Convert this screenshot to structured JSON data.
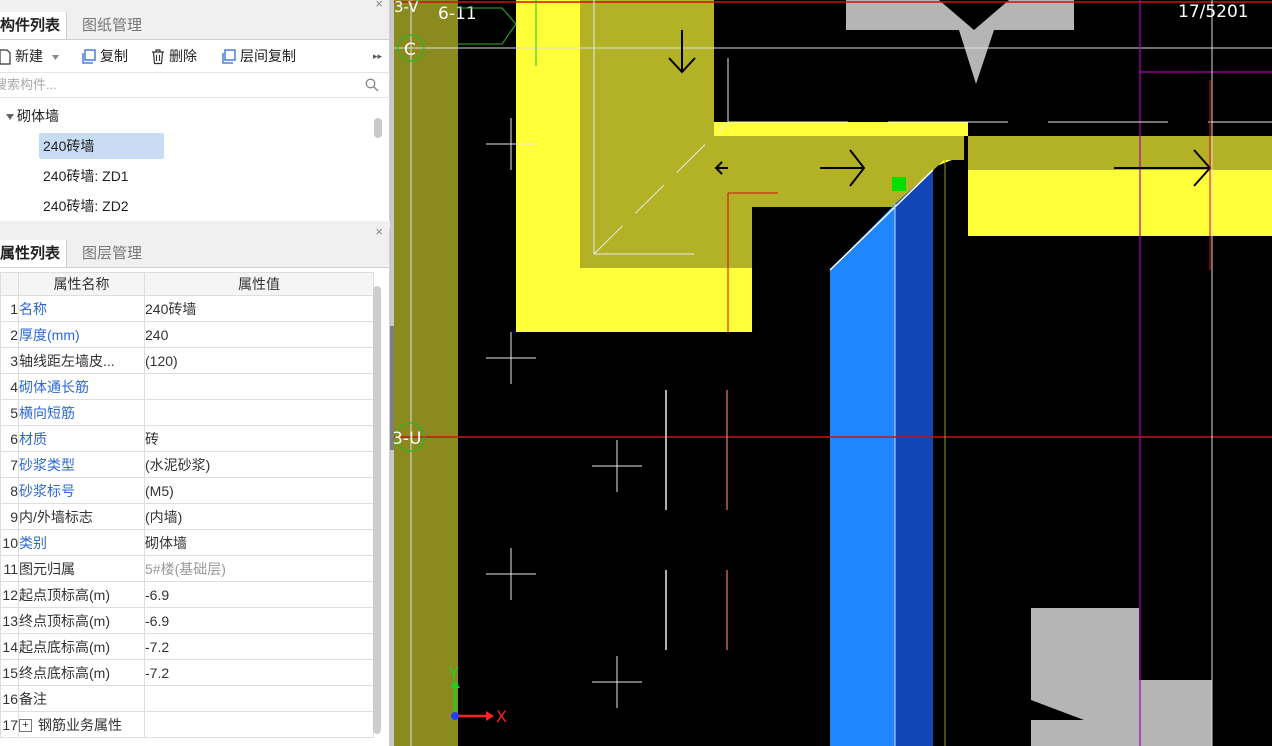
{
  "component_panel": {
    "tabs": [
      {
        "label": "构件列表",
        "active": true
      },
      {
        "label": "图纸管理",
        "active": false
      }
    ],
    "close": "×",
    "toolbar": {
      "new": "新建",
      "copy": "复制",
      "delete": "删除",
      "floor_copy": "层间复制",
      "more": "▸▸"
    },
    "search_placeholder": "搜索构件...",
    "tree": {
      "group": "砌体墙",
      "items": [
        {
          "label": "240砖墙",
          "selected": true
        },
        {
          "label": "240砖墙: ZD1",
          "selected": false
        },
        {
          "label": "240砖墙: ZD2",
          "selected": false
        }
      ]
    }
  },
  "property_panel": {
    "tabs": [
      {
        "label": "属性列表",
        "active": true
      },
      {
        "label": "图层管理",
        "active": false
      }
    ],
    "close": "×",
    "headers": {
      "name": "属性名称",
      "value": "属性值"
    },
    "rows": [
      {
        "no": "1",
        "name": "名称",
        "value": "240砖墙",
        "blue": true
      },
      {
        "no": "2",
        "name": "厚度(mm)",
        "value": "240",
        "blue": true
      },
      {
        "no": "3",
        "name": "轴线距左墙皮...",
        "value": "(120)",
        "blue": false
      },
      {
        "no": "4",
        "name": "砌体通长筋",
        "value": "",
        "blue": true
      },
      {
        "no": "5",
        "name": "横向短筋",
        "value": "",
        "blue": true
      },
      {
        "no": "6",
        "name": "材质",
        "value": "砖",
        "blue": true
      },
      {
        "no": "7",
        "name": "砂浆类型",
        "value": "(水泥砂浆)",
        "blue": true
      },
      {
        "no": "8",
        "name": "砂浆标号",
        "value": "(M5)",
        "blue": true
      },
      {
        "no": "9",
        "name": "内/外墙标志",
        "value": "(内墙)",
        "blue": false
      },
      {
        "no": "10",
        "name": "类别",
        "value": "砌体墙",
        "blue": true
      },
      {
        "no": "11",
        "name": "图元归属",
        "value": "5#楼(基础层)",
        "blue": false,
        "value_gray": true
      },
      {
        "no": "12",
        "name": "起点顶标高(m)",
        "value": "-6.9",
        "blue": false
      },
      {
        "no": "13",
        "name": "终点顶标高(m)",
        "value": "-6.9",
        "blue": false
      },
      {
        "no": "14",
        "name": "起点底标高(m)",
        "value": "-7.2",
        "blue": false
      },
      {
        "no": "15",
        "name": "终点底标高(m)",
        "value": "-7.2",
        "blue": false
      },
      {
        "no": "16",
        "name": "备注",
        "value": "",
        "blue": false
      },
      {
        "no": "17",
        "name": "钢筋业务属性",
        "value": "",
        "blue": false,
        "expandable": true
      }
    ]
  },
  "canvas": {
    "axis_labels": {
      "top_left": "3-V",
      "grid_6_11": "6-11",
      "c": "C",
      "mid": "3-U",
      "top_right": "17/5201"
    },
    "coord_axes": {
      "x": "X",
      "y": "Y"
    }
  },
  "colors": {
    "wall_yellow": "#ffff3a",
    "wall_olive": "#b3b226",
    "wall_dark_olive": "#8a8a1e",
    "wall_blue": "#1f86ff",
    "wall_dark_blue": "#1245b5",
    "axis_red": "#d01010",
    "magenta": "#b000b0",
    "gray_block": "#b5b5b5",
    "selected_blue": "#c7dcf3",
    "link_blue": "#2d6ad6"
  }
}
